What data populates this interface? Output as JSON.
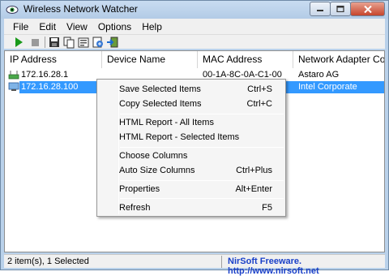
{
  "window": {
    "title": "Wireless Network Watcher",
    "caption_buttons": [
      "minimize",
      "maximize",
      "close"
    ]
  },
  "menubar": {
    "items": [
      {
        "label": "File"
      },
      {
        "label": "Edit"
      },
      {
        "label": "View"
      },
      {
        "label": "Options"
      },
      {
        "label": "Help"
      }
    ]
  },
  "toolbar": {
    "buttons": [
      {
        "icon": "play-icon",
        "color": "#1a9a1a"
      },
      {
        "icon": "stop-icon",
        "color": "#9a9a9a"
      },
      {
        "icon": "save-icon"
      },
      {
        "icon": "copy-icon"
      },
      {
        "icon": "properties-icon"
      },
      {
        "icon": "html-report-icon"
      },
      {
        "icon": "exit-icon"
      }
    ]
  },
  "list": {
    "columns": [
      {
        "label": "IP Address"
      },
      {
        "label": "Device Name"
      },
      {
        "label": "MAC Address"
      },
      {
        "label": "Network Adapter Comp..."
      }
    ],
    "rows": [
      {
        "ip": "172.16.28.1",
        "device": "",
        "mac": "00-1A-8C-0A-C1-00",
        "adapter": "Astaro AG",
        "selected": false
      },
      {
        "ip": "172.16.28.100",
        "device": "",
        "mac": "",
        "adapter": "Intel Corporate",
        "selected": true
      }
    ],
    "selection_color": "#3399ff"
  },
  "context_menu": {
    "items": [
      {
        "label": "Save Selected Items",
        "shortcut": "Ctrl+S"
      },
      {
        "label": "Copy Selected Items",
        "shortcut": "Ctrl+C"
      },
      {
        "label": "HTML Report - All Items",
        "shortcut": ""
      },
      {
        "label": "HTML Report - Selected Items",
        "shortcut": ""
      },
      {
        "label": "Choose Columns",
        "shortcut": ""
      },
      {
        "label": "Auto Size Columns",
        "shortcut": "Ctrl+Plus"
      },
      {
        "label": "Properties",
        "shortcut": "Alt+Enter"
      },
      {
        "label": "Refresh",
        "shortcut": "F5"
      }
    ]
  },
  "statusbar": {
    "left": "2 item(s), 1 Selected",
    "right": "NirSoft Freeware.  http://www.nirsoft.net",
    "link_color": "#1a40c8"
  }
}
